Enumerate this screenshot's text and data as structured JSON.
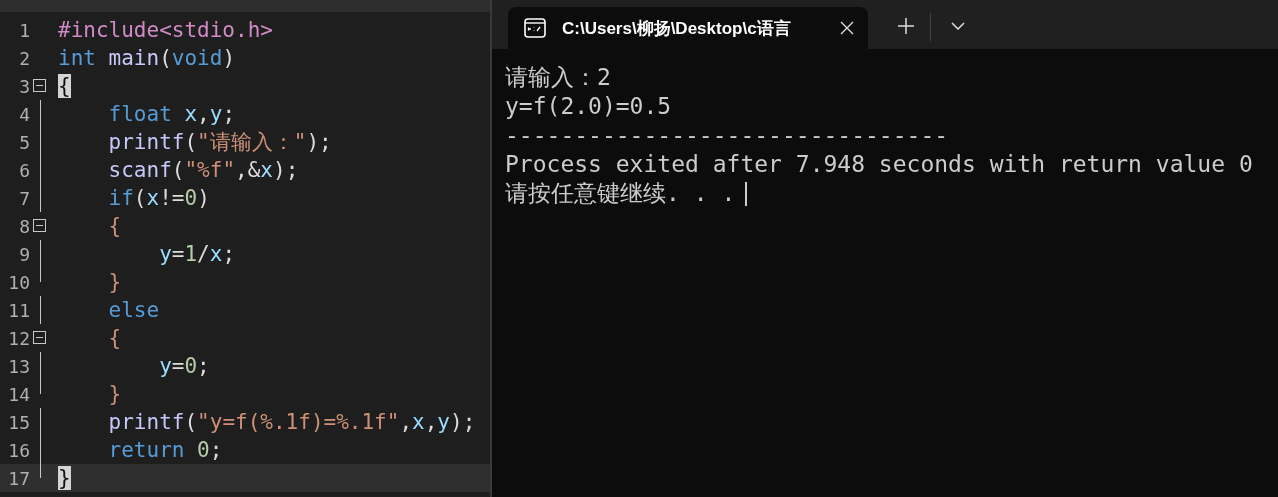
{
  "editor": {
    "lines": [
      {
        "number": "1",
        "kind": "plain",
        "current": false,
        "tokens": [
          {
            "text": "#include<stdio.h>",
            "kind": "pre"
          }
        ]
      },
      {
        "number": "2",
        "kind": "plain",
        "current": false,
        "tokens": [
          {
            "text": "int ",
            "kind": "kw"
          },
          {
            "text": "main",
            "kind": "fn"
          },
          {
            "text": "(",
            "kind": "plain"
          },
          {
            "text": "void",
            "kind": "kw"
          },
          {
            "text": ")",
            "kind": "plain"
          }
        ]
      },
      {
        "number": "3",
        "kind": "fold-start",
        "current": false,
        "tokens": [
          {
            "text": "{",
            "kind": "match"
          }
        ]
      },
      {
        "number": "4",
        "kind": "fold-body",
        "current": false,
        "tokens": [
          {
            "text": "    float ",
            "kind": "kw"
          },
          {
            "text": "x",
            "kind": "var"
          },
          {
            "text": ",",
            "kind": "plain"
          },
          {
            "text": "y",
            "kind": "var"
          },
          {
            "text": ";",
            "kind": "plain"
          }
        ]
      },
      {
        "number": "5",
        "kind": "fold-body",
        "current": false,
        "tokens": [
          {
            "text": "    printf",
            "kind": "fn"
          },
          {
            "text": "(",
            "kind": "plain"
          },
          {
            "text": "\"请输入：\"",
            "kind": "str"
          },
          {
            "text": ");",
            "kind": "plain"
          }
        ]
      },
      {
        "number": "6",
        "kind": "fold-body",
        "current": false,
        "tokens": [
          {
            "text": "    scanf",
            "kind": "fn"
          },
          {
            "text": "(",
            "kind": "plain"
          },
          {
            "text": "\"%f\"",
            "kind": "str"
          },
          {
            "text": ",&",
            "kind": "plain"
          },
          {
            "text": "x",
            "kind": "var"
          },
          {
            "text": ");",
            "kind": "plain"
          }
        ]
      },
      {
        "number": "7",
        "kind": "fold-body",
        "current": false,
        "tokens": [
          {
            "text": "    if",
            "kind": "kw"
          },
          {
            "text": "(",
            "kind": "plain"
          },
          {
            "text": "x",
            "kind": "var"
          },
          {
            "text": "!=",
            "kind": "plain"
          },
          {
            "text": "0",
            "kind": "num"
          },
          {
            "text": ")",
            "kind": "plain"
          }
        ]
      },
      {
        "number": "8",
        "kind": "fold-start",
        "current": false,
        "tokens": [
          {
            "text": "    {",
            "kind": "brace"
          }
        ]
      },
      {
        "number": "9",
        "kind": "fold-body",
        "current": false,
        "tokens": [
          {
            "text": "        y",
            "kind": "var"
          },
          {
            "text": "=",
            "kind": "plain"
          },
          {
            "text": "1",
            "kind": "num"
          },
          {
            "text": "/",
            "kind": "plain"
          },
          {
            "text": "x",
            "kind": "var"
          },
          {
            "text": ";",
            "kind": "plain"
          }
        ]
      },
      {
        "number": "10",
        "kind": "fold-end",
        "current": false,
        "tokens": [
          {
            "text": "    }",
            "kind": "brace"
          }
        ]
      },
      {
        "number": "11",
        "kind": "fold-body",
        "current": false,
        "tokens": [
          {
            "text": "    else",
            "kind": "kw"
          }
        ]
      },
      {
        "number": "12",
        "kind": "fold-start",
        "current": false,
        "tokens": [
          {
            "text": "    {",
            "kind": "brace"
          }
        ]
      },
      {
        "number": "13",
        "kind": "fold-body",
        "current": false,
        "tokens": [
          {
            "text": "        y",
            "kind": "var"
          },
          {
            "text": "=",
            "kind": "plain"
          },
          {
            "text": "0",
            "kind": "num"
          },
          {
            "text": ";",
            "kind": "plain"
          }
        ]
      },
      {
        "number": "14",
        "kind": "fold-end",
        "current": false,
        "tokens": [
          {
            "text": "    }",
            "kind": "brace"
          }
        ]
      },
      {
        "number": "15",
        "kind": "fold-body",
        "current": false,
        "tokens": [
          {
            "text": "    printf",
            "kind": "fn"
          },
          {
            "text": "(",
            "kind": "plain"
          },
          {
            "text": "\"y=f(%.1f)=%.1f\"",
            "kind": "str"
          },
          {
            "text": ",",
            "kind": "plain"
          },
          {
            "text": "x",
            "kind": "var"
          },
          {
            "text": ",",
            "kind": "plain"
          },
          {
            "text": "y",
            "kind": "var"
          },
          {
            "text": ");",
            "kind": "plain"
          }
        ]
      },
      {
        "number": "16",
        "kind": "fold-body",
        "current": false,
        "tokens": [
          {
            "text": "    return ",
            "kind": "kw"
          },
          {
            "text": "0",
            "kind": "num"
          },
          {
            "text": ";",
            "kind": "plain"
          }
        ]
      },
      {
        "number": "17",
        "kind": "fold-end",
        "current": true,
        "tokens": [
          {
            "text": "}",
            "kind": "match"
          }
        ]
      }
    ]
  },
  "terminal": {
    "tab": {
      "title": "C:\\Users\\柳扬\\Desktop\\c语言"
    },
    "output": [
      "请输入：2",
      "y=f(2.0)=0.5",
      "--------------------------------",
      "Process exited after 7.948 seconds with return value 0",
      "请按任意键继续. . ."
    ]
  }
}
